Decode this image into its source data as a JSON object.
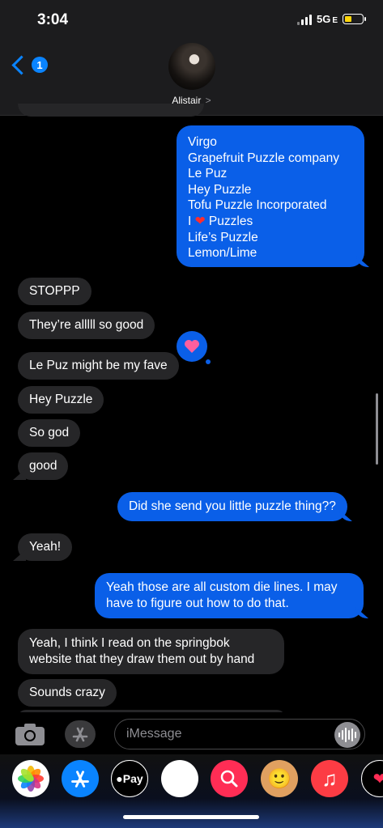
{
  "status": {
    "time": "3:04",
    "network": "5G",
    "network_suffix": "E"
  },
  "header": {
    "unread_count": "1",
    "contact_name": "Alistair",
    "chevron": ">"
  },
  "messages": [
    {
      "side": "out",
      "lines": [
        "Virgo",
        "Grapefruit Puzzle company",
        "Le Puz",
        "Hey Puzzle",
        "Tofu Puzzle Incorporated",
        "I ❤️ Puzzles",
        "Life’s Puzzle",
        "Lemon/Lime"
      ]
    },
    {
      "side": "in",
      "text": "STOPPP"
    },
    {
      "side": "in",
      "text": "They’re alllll so good",
      "tapback": "heart"
    },
    {
      "side": "in",
      "text": "Le Puz might be my fave"
    },
    {
      "side": "in",
      "text": "Hey Puzzle"
    },
    {
      "side": "in",
      "text": "So god"
    },
    {
      "side": "in",
      "text": "good"
    },
    {
      "side": "out",
      "text": "Did she send you little puzzle thing??"
    },
    {
      "side": "in",
      "text": "Yeah!"
    },
    {
      "side": "out",
      "lines": [
        "Yeah those are all custom die lines. I may",
        "have to figure out how to do that."
      ]
    },
    {
      "side": "in",
      "lines": [
        "Yeah, I think I read on the springbok",
        "website that they draw them out by hand"
      ]
    },
    {
      "side": "in",
      "text": "Sounds crazy"
    }
  ],
  "input": {
    "placeholder": "iMessage"
  },
  "app_drawer": [
    {
      "name": "photos-icon",
      "label": "",
      "color": "#ffffff"
    },
    {
      "name": "app-store-icon",
      "label": "",
      "color": "#0a84ff"
    },
    {
      "name": "apple-pay-icon",
      "label": "Pay",
      "color": "#ffffff"
    },
    {
      "name": "memoji-stickers-icon",
      "label": "",
      "color": "#ffffff"
    },
    {
      "name": "web-search-icon",
      "label": "",
      "color": "#ff2d55"
    },
    {
      "name": "memoji-icon",
      "label": "",
      "color": "#ffffff"
    },
    {
      "name": "music-icon",
      "label": "",
      "color": "#fc3c44"
    },
    {
      "name": "digital-touch-icon",
      "label": "",
      "color": "#ffffff"
    }
  ],
  "colors": {
    "outgoing": "#0a5fe8",
    "incoming": "#262628",
    "accent": "#0a84ff"
  }
}
